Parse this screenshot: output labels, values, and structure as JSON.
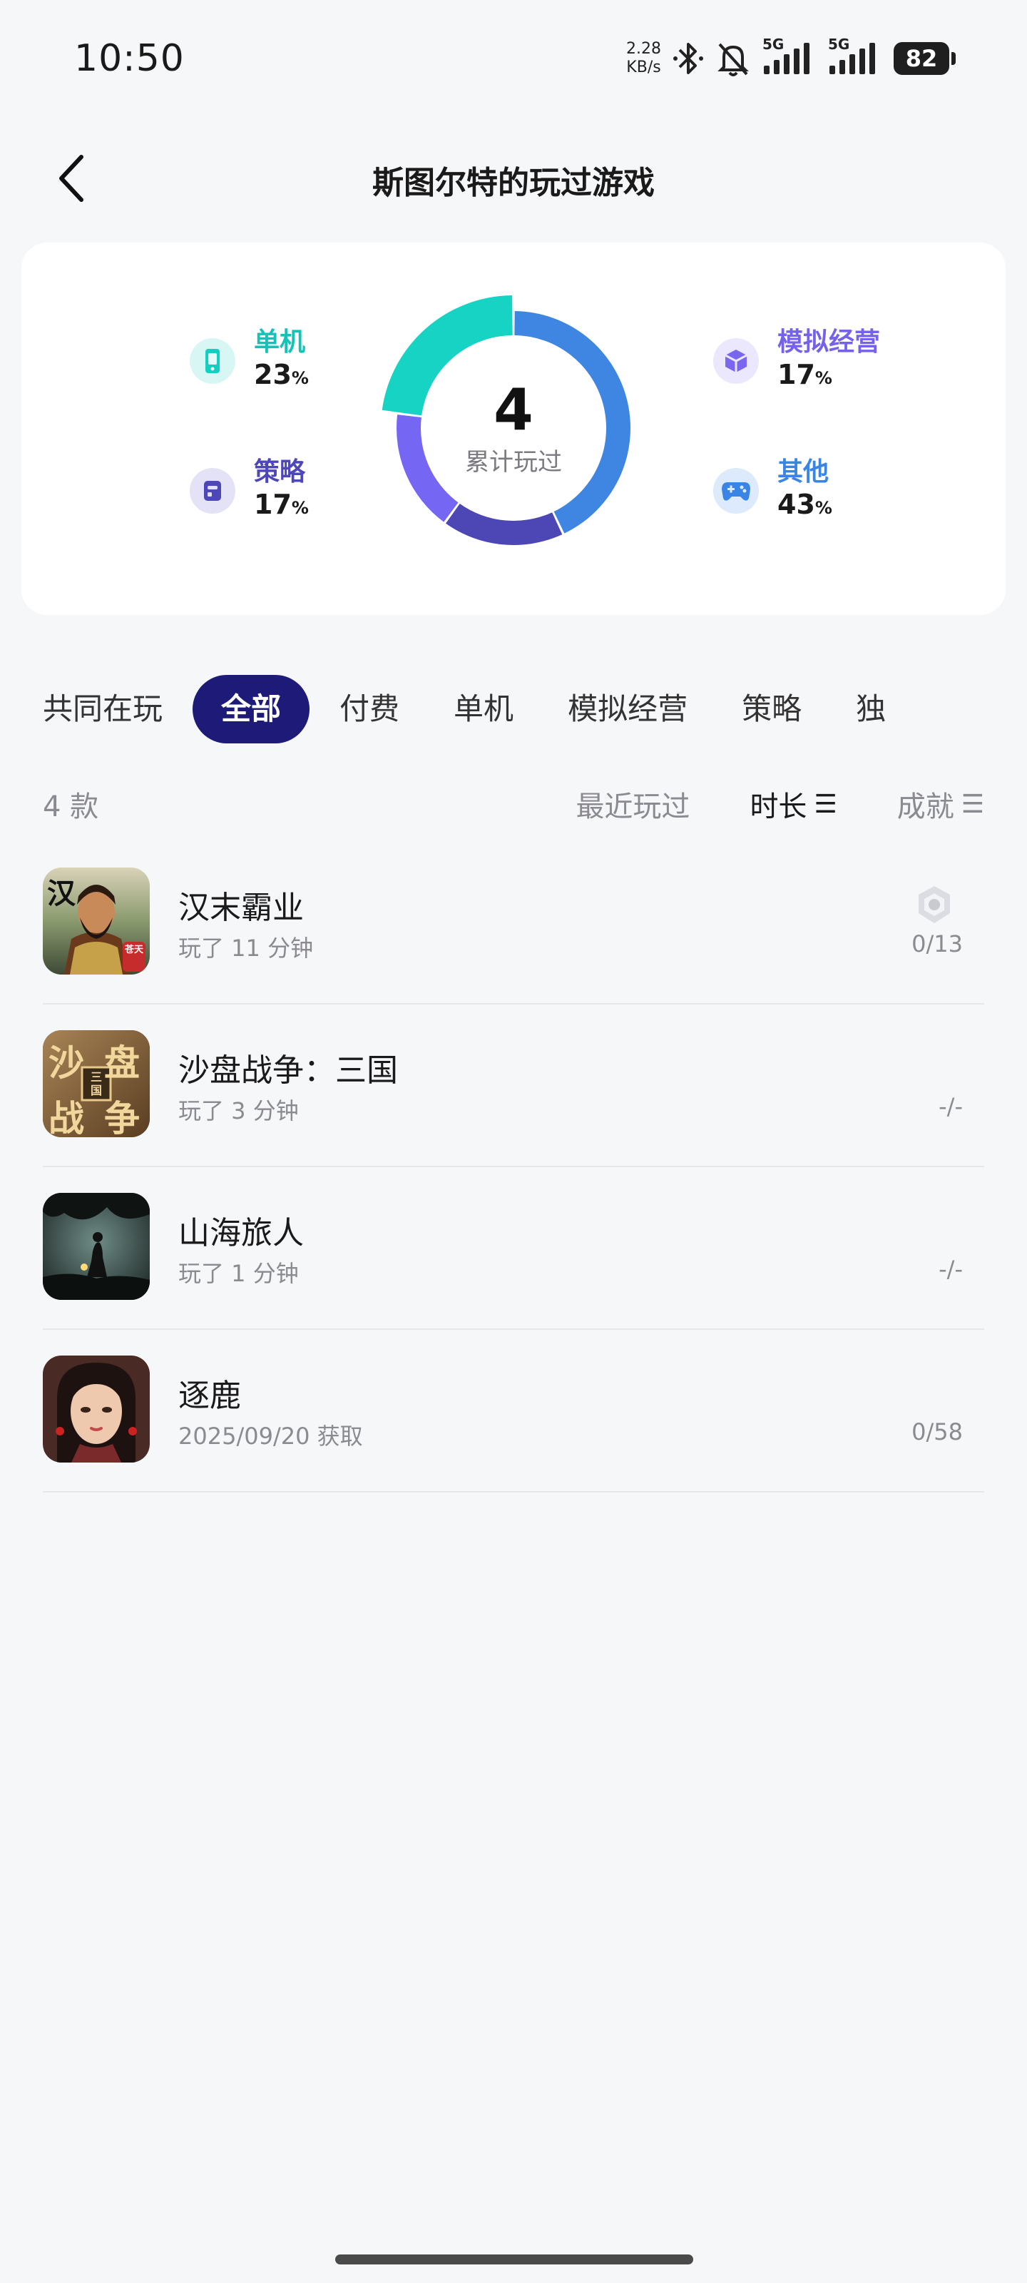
{
  "status_bar": {
    "time": "10:50",
    "net_speed_value": "2.28",
    "net_speed_unit": "KB/s",
    "signal1_label": "5G",
    "signal2_label": "5G",
    "battery": "82"
  },
  "nav": {
    "title": "斯图尔特的玩过游戏"
  },
  "summary": {
    "total": "4",
    "total_label": "累计玩过",
    "categories": [
      {
        "name": "单机",
        "percent": "23",
        "unit": "%",
        "color": "#12cfc0",
        "icon": "phone-icon"
      },
      {
        "name": "策略",
        "percent": "17",
        "unit": "%",
        "color": "#4e47b8",
        "icon": "strategy-icon"
      },
      {
        "name": "模拟经营",
        "percent": "17",
        "unit": "%",
        "color": "#7a67f0",
        "icon": "blocks-icon"
      },
      {
        "name": "其他",
        "percent": "43",
        "unit": "%",
        "color": "#3a84e6",
        "icon": "gamepad-icon"
      }
    ],
    "donut_segments": [
      {
        "name": "其他",
        "value": 43,
        "color": "#3e86e2"
      },
      {
        "name": "策略",
        "value": 17,
        "color": "#4d46b5"
      },
      {
        "name": "模拟经营",
        "value": 17,
        "color": "#7566f4"
      },
      {
        "name": "单机",
        "value": 23,
        "color": "#17d3c4"
      }
    ]
  },
  "tabs": [
    {
      "label": "共同在玩",
      "active": false
    },
    {
      "label": "全部",
      "active": true
    },
    {
      "label": "付费",
      "active": false
    },
    {
      "label": "单机",
      "active": false
    },
    {
      "label": "模拟经营",
      "active": false
    },
    {
      "label": "策略",
      "active": false
    },
    {
      "label": "独",
      "active": false
    }
  ],
  "list_header": {
    "count": "4 款",
    "sort_recent": "最近玩过",
    "sort_duration": "时长",
    "sort_achievement": "成就",
    "sort_icon": "☰"
  },
  "games": [
    {
      "name": "汉末霸业",
      "subtitle": "玩了 11 分钟",
      "achievement": "0/13",
      "has_trophy": true
    },
    {
      "name": "沙盘战争：三国",
      "subtitle": "玩了 3 分钟",
      "achievement": "-/-",
      "has_trophy": false
    },
    {
      "name": "山海旅人",
      "subtitle": "玩了 1 分钟",
      "achievement": "-/-",
      "has_trophy": false
    },
    {
      "name": "逐鹿",
      "subtitle": "2025/09/20 获取",
      "achievement": "0/58",
      "has_trophy": false
    }
  ],
  "covers": {
    "game1_text": "汉",
    "game1_seal": "苍天",
    "game2_chars": [
      "沙",
      "盘",
      "战",
      "争"
    ],
    "game2_center": "三国"
  }
}
